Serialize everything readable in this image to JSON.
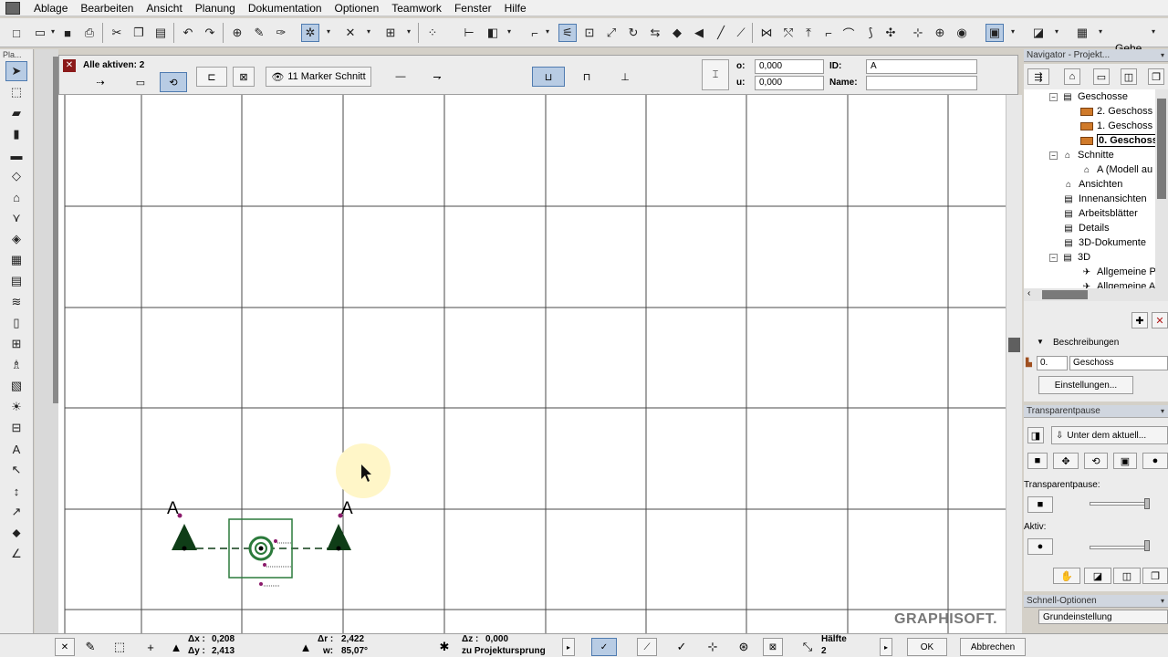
{
  "menu": [
    "Ablage",
    "Bearbeiten",
    "Ansicht",
    "Planung",
    "Dokumentation",
    "Optionen",
    "Teamwork",
    "Fenster",
    "Hilfe"
  ],
  "toolbar": {
    "gehe_label": "Gehe"
  },
  "toolbox": {
    "title": "Pla..."
  },
  "infobox": {
    "title": "Alle aktiven: 2",
    "marker_label": "11 Marker Schnitt",
    "o_label": "o:",
    "o_value": "0,000",
    "u_label": "u:",
    "u_value": "0,000",
    "id_label": "ID:",
    "id_value": "A",
    "name_label": "Name:",
    "name_value": ""
  },
  "canvas": {
    "section_label_left": "A",
    "section_label_right": "A",
    "watermark": "GRAPHISOFT."
  },
  "navigator": {
    "title": "Navigator - Projekt...",
    "tree": [
      {
        "label": "Geschosse",
        "level": 1,
        "expander": "−",
        "icon": "stories-icon"
      },
      {
        "label": "2. Geschoss",
        "level": 2,
        "icon": "story-icon"
      },
      {
        "label": "1. Geschoss",
        "level": 2,
        "icon": "story-icon"
      },
      {
        "label": "0. Geschoss",
        "level": 2,
        "icon": "story-icon",
        "bold": true
      },
      {
        "label": "Schnitte",
        "level": 1,
        "expander": "−",
        "icon": "sections-icon"
      },
      {
        "label": "A (Modell au",
        "level": 2,
        "icon": "section-icon"
      },
      {
        "label": "Ansichten",
        "level": 1,
        "icon": "elevations-icon"
      },
      {
        "label": "Innenansichten",
        "level": 1,
        "icon": "interior-icon"
      },
      {
        "label": "Arbeitsblätter",
        "level": 1,
        "icon": "worksheet-icon"
      },
      {
        "label": "Details",
        "level": 1,
        "icon": "details-icon"
      },
      {
        "label": "3D-Dokumente",
        "level": 1,
        "icon": "3d-doc-icon"
      },
      {
        "label": "3D",
        "level": 1,
        "expander": "−",
        "icon": "3d-icon"
      },
      {
        "label": "Allgemeine P",
        "level": 2,
        "icon": "camera-icon"
      },
      {
        "label": "Allgemeine A",
        "level": 2,
        "icon": "camera-icon"
      }
    ],
    "beschreibungen_label": "Beschreibungen",
    "story_number": "0.",
    "story_name": "Geschoss",
    "einstellungen_label": "Einstellungen..."
  },
  "transparentpause": {
    "title": "Transparentpause",
    "dropdown": "Unter dem aktuell...",
    "tp_label": "Transparentpause:",
    "aktiv_label": "Aktiv:"
  },
  "schnell": {
    "title": "Schnell-Optionen",
    "dropdown": "Grundeinstellung"
  },
  "status": {
    "dx_label": "Δx :",
    "dx_value": "0,208",
    "dy_label": "Δy :",
    "dy_value": "2,413",
    "dr_label": "Δr :",
    "dr_value": "2,422",
    "w_label": "w:",
    "w_value": "85,07°",
    "dz_label": "Δz :",
    "dz_value": "0,000",
    "projektursprung": "zu Projektursprung",
    "haelfte_label": "Hälfte",
    "haelfte_value": "2",
    "ok_label": "OK",
    "abbrechen_label": "Abbrechen"
  },
  "colors": {
    "marker_dark_green": "#0f3d17",
    "marker_green": "#2b7a3b",
    "magenta": "#8b1a6b",
    "grid": "#4a4a4a",
    "cursor_highlight": "#fff6c8"
  }
}
